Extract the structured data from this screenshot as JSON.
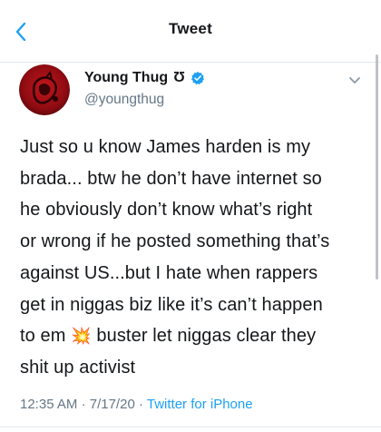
{
  "nav": {
    "title": "Tweet",
    "back_icon": "chevron-left-icon"
  },
  "author": {
    "name": "Young Thug",
    "name_glyph": "Ʊ",
    "handle": "@youngthug",
    "verified_icon": "verified-badge-icon",
    "caret_icon": "chevron-down-icon"
  },
  "tweet": {
    "lines": [
      "Just so u know James harden is my",
      "brada... btw he don’t have internet so",
      "he obviously don’t know what’s right",
      "or wrong if he posted something that’s",
      "against US...but I hate when rappers",
      "get in niggas biz like it’s can’t happen",
      "to em",
      "buster let niggas clear they",
      "shit up activist"
    ],
    "emoji": "💥",
    "time": "12:35 AM",
    "separator": "·",
    "date": "7/17/20",
    "source": "Twitter for iPhone"
  },
  "colors": {
    "link_blue": "#1da1f2",
    "muted_gray": "#657786",
    "text": "#14171a"
  }
}
